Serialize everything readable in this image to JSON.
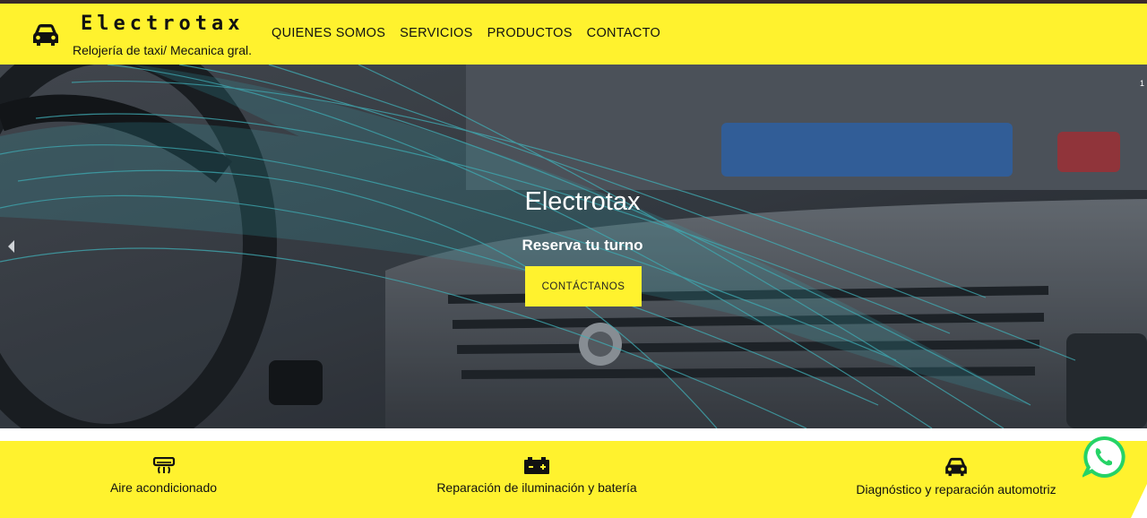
{
  "header": {
    "brand_name": "Electrotax",
    "tagline": "Relojería de taxi/ Mecanica gral.",
    "brand_icon": "car-icon",
    "nav": [
      {
        "label": "QUIENES SOMOS"
      },
      {
        "label": "SERVICIOS"
      },
      {
        "label": "PRODUCTOS"
      },
      {
        "label": "CONTACTO"
      }
    ]
  },
  "hero": {
    "title": "Electrotax",
    "subtitle": "Reserva tu turno",
    "cta_label": "CONTÁCTANOS",
    "slide_indicator": "1",
    "prev_icon": "chevron-left-icon"
  },
  "features": [
    {
      "label": "Aire acondicionado",
      "icon": "air-conditioner-icon"
    },
    {
      "label": "Reparación de iluminación y batería",
      "icon": "battery-icon"
    },
    {
      "label": "Diagnóstico y reparación automotriz",
      "icon": "car-icon"
    }
  ],
  "floating": {
    "icon": "whatsapp-icon"
  },
  "colors": {
    "accent": "#fff22e",
    "text": "#111111",
    "whatsapp": "#25d366"
  }
}
